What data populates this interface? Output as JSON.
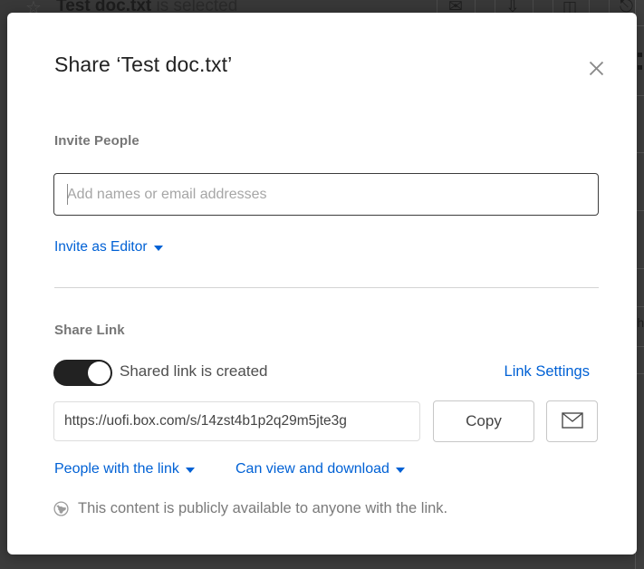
{
  "background": {
    "header": {
      "star_icon": "star-outline-icon",
      "file_name": "Test doc.txt",
      "status_text": " is selected",
      "actions": [
        {
          "icon": "envelope-icon",
          "glyph": "✉"
        },
        {
          "icon": "download-arrow-icon",
          "glyph": "⇩"
        },
        {
          "icon": "document-list-icon",
          "glyph": "☰"
        },
        {
          "icon": "trash-icon",
          "glyph": "Ὕ1"
        }
      ]
    },
    "right_panel_text": "Sh"
  },
  "dialog": {
    "title": "Share ‘Test doc.txt’",
    "close_icon": "close-icon",
    "invite": {
      "section_label": "Invite People",
      "input_value": "",
      "input_placeholder": "Add names or email addresses",
      "role_link": "Invite as Editor",
      "role_caret_icon": "chevron-down-icon"
    },
    "share_link": {
      "section_label": "Share Link",
      "toggle_state": "on",
      "toggle_text": "Shared link is created",
      "link_settings_label": "Link Settings",
      "url": "https://uofi.box.com/s/14zst4b1p2q29m5jte3g",
      "copy_label": "Copy",
      "email_icon": "envelope-icon",
      "audience_label": "People with the link",
      "permission_label": "Can view and download",
      "notice_icon": "globe-icon",
      "notice_text": "This content is publicly available to anyone with the link."
    }
  },
  "colors": {
    "accent_blue": "#0061d5",
    "toggle_on": "#222222",
    "backdrop": "#3c3c3c",
    "muted_text": "#767676"
  }
}
